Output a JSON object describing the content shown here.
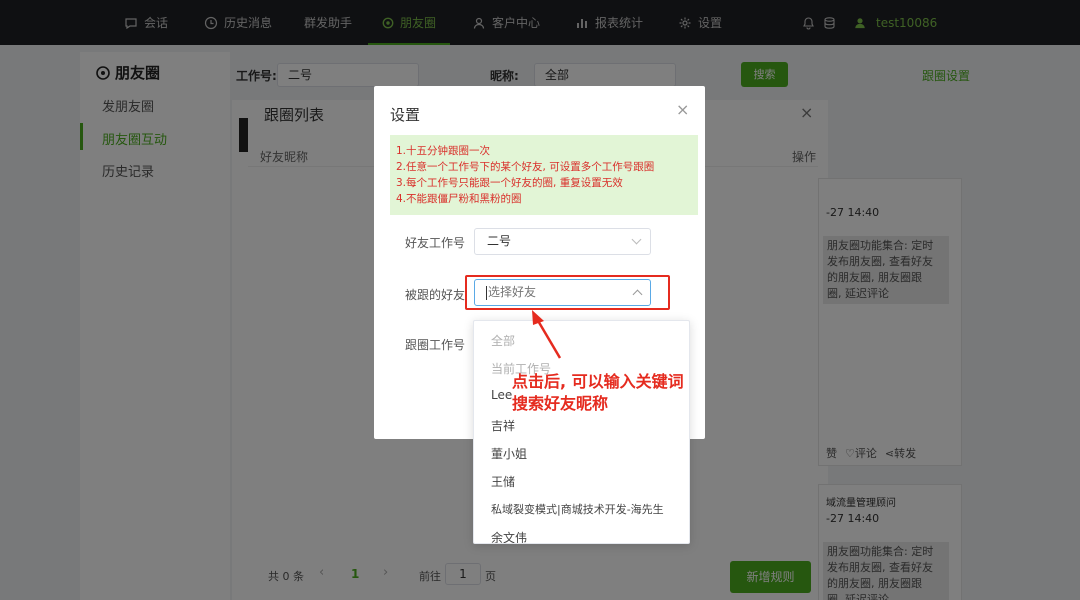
{
  "nav": {
    "items": [
      {
        "label": "会话",
        "icon": "chat-icon"
      },
      {
        "label": "历史消息",
        "icon": "clock-icon"
      },
      {
        "label": "群发助手",
        "icon": ""
      },
      {
        "label": "朋友圈",
        "icon": "moments-icon"
      },
      {
        "label": "客户中心",
        "icon": "user-icon"
      },
      {
        "label": "报表统计",
        "icon": "chart-icon"
      },
      {
        "label": "设置",
        "icon": "gear-icon"
      }
    ],
    "active": "朋友圈",
    "username": "test10086"
  },
  "sidebar": {
    "title": "朋友圈",
    "items": [
      "发朋友圈",
      "朋友圈互动",
      "历史记录"
    ],
    "active": "朋友圈互动"
  },
  "filter": {
    "workno_label": "工作号:",
    "workno_value": "二号",
    "nickname_label": "昵称:",
    "nickname_value": "全部",
    "search_btn": "搜索",
    "follow_settings": "跟圈设置"
  },
  "follow_panel": {
    "title": "跟圈列表",
    "col_nickname": "好友昵称",
    "col_action": "操作",
    "total": "共 0 条",
    "page": "1",
    "goto_label": "前往",
    "goto_value": "1",
    "page_unit": "页",
    "add_rule_btn": "新增规则"
  },
  "background_posts": [
    {
      "time": "-27 14:40",
      "text": [
        "朋友圈功能集合: 定时",
        "发布朋友圈, 查看好友",
        "的朋友圈, 朋友圈跟",
        "圈, 延迟评论"
      ],
      "actions": [
        "赞",
        "评论",
        "转发"
      ]
    },
    {
      "title": "域流量管理顾问",
      "time": "-27 14:40",
      "text": [
        "朋友圈功能集合: 定时",
        "发布朋友圈, 查看好友",
        "的朋友圈, 朋友圈跟",
        "圈, 延迟评论"
      ]
    }
  ],
  "dialog": {
    "title": "设置",
    "notice": [
      "1.十五分钟跟圈一次",
      "2.任意一个工作号下的某个好友, 可设置多个工作号跟圈",
      "3.每个工作号只能跟一个好友的圈, 重复设置无效",
      "4.不能跟僵尸粉和黑粉的圈"
    ],
    "friend_workno_label": "好友工作号",
    "friend_workno_value": "二号",
    "followed_friend_label": "被跟的好友",
    "followed_friend_placeholder": "选择好友",
    "follow_workno_label": "跟圈工作号"
  },
  "dropdown": {
    "options": [
      "全部",
      "当前工作号",
      "Lee",
      "吉祥",
      "董小姐",
      "王储",
      "私域裂变模式|商城技术开发-海先生",
      "余文伟"
    ],
    "disabled": [
      "全部",
      "当前工作号"
    ]
  },
  "annotation": {
    "line1": "点击后, 可以输入关键词",
    "line2": "搜索好友昵称"
  },
  "colors": {
    "brand_green": "#4caf1f",
    "annotation_red": "#e52b1f",
    "notice_bg": "#e2f5d6"
  }
}
